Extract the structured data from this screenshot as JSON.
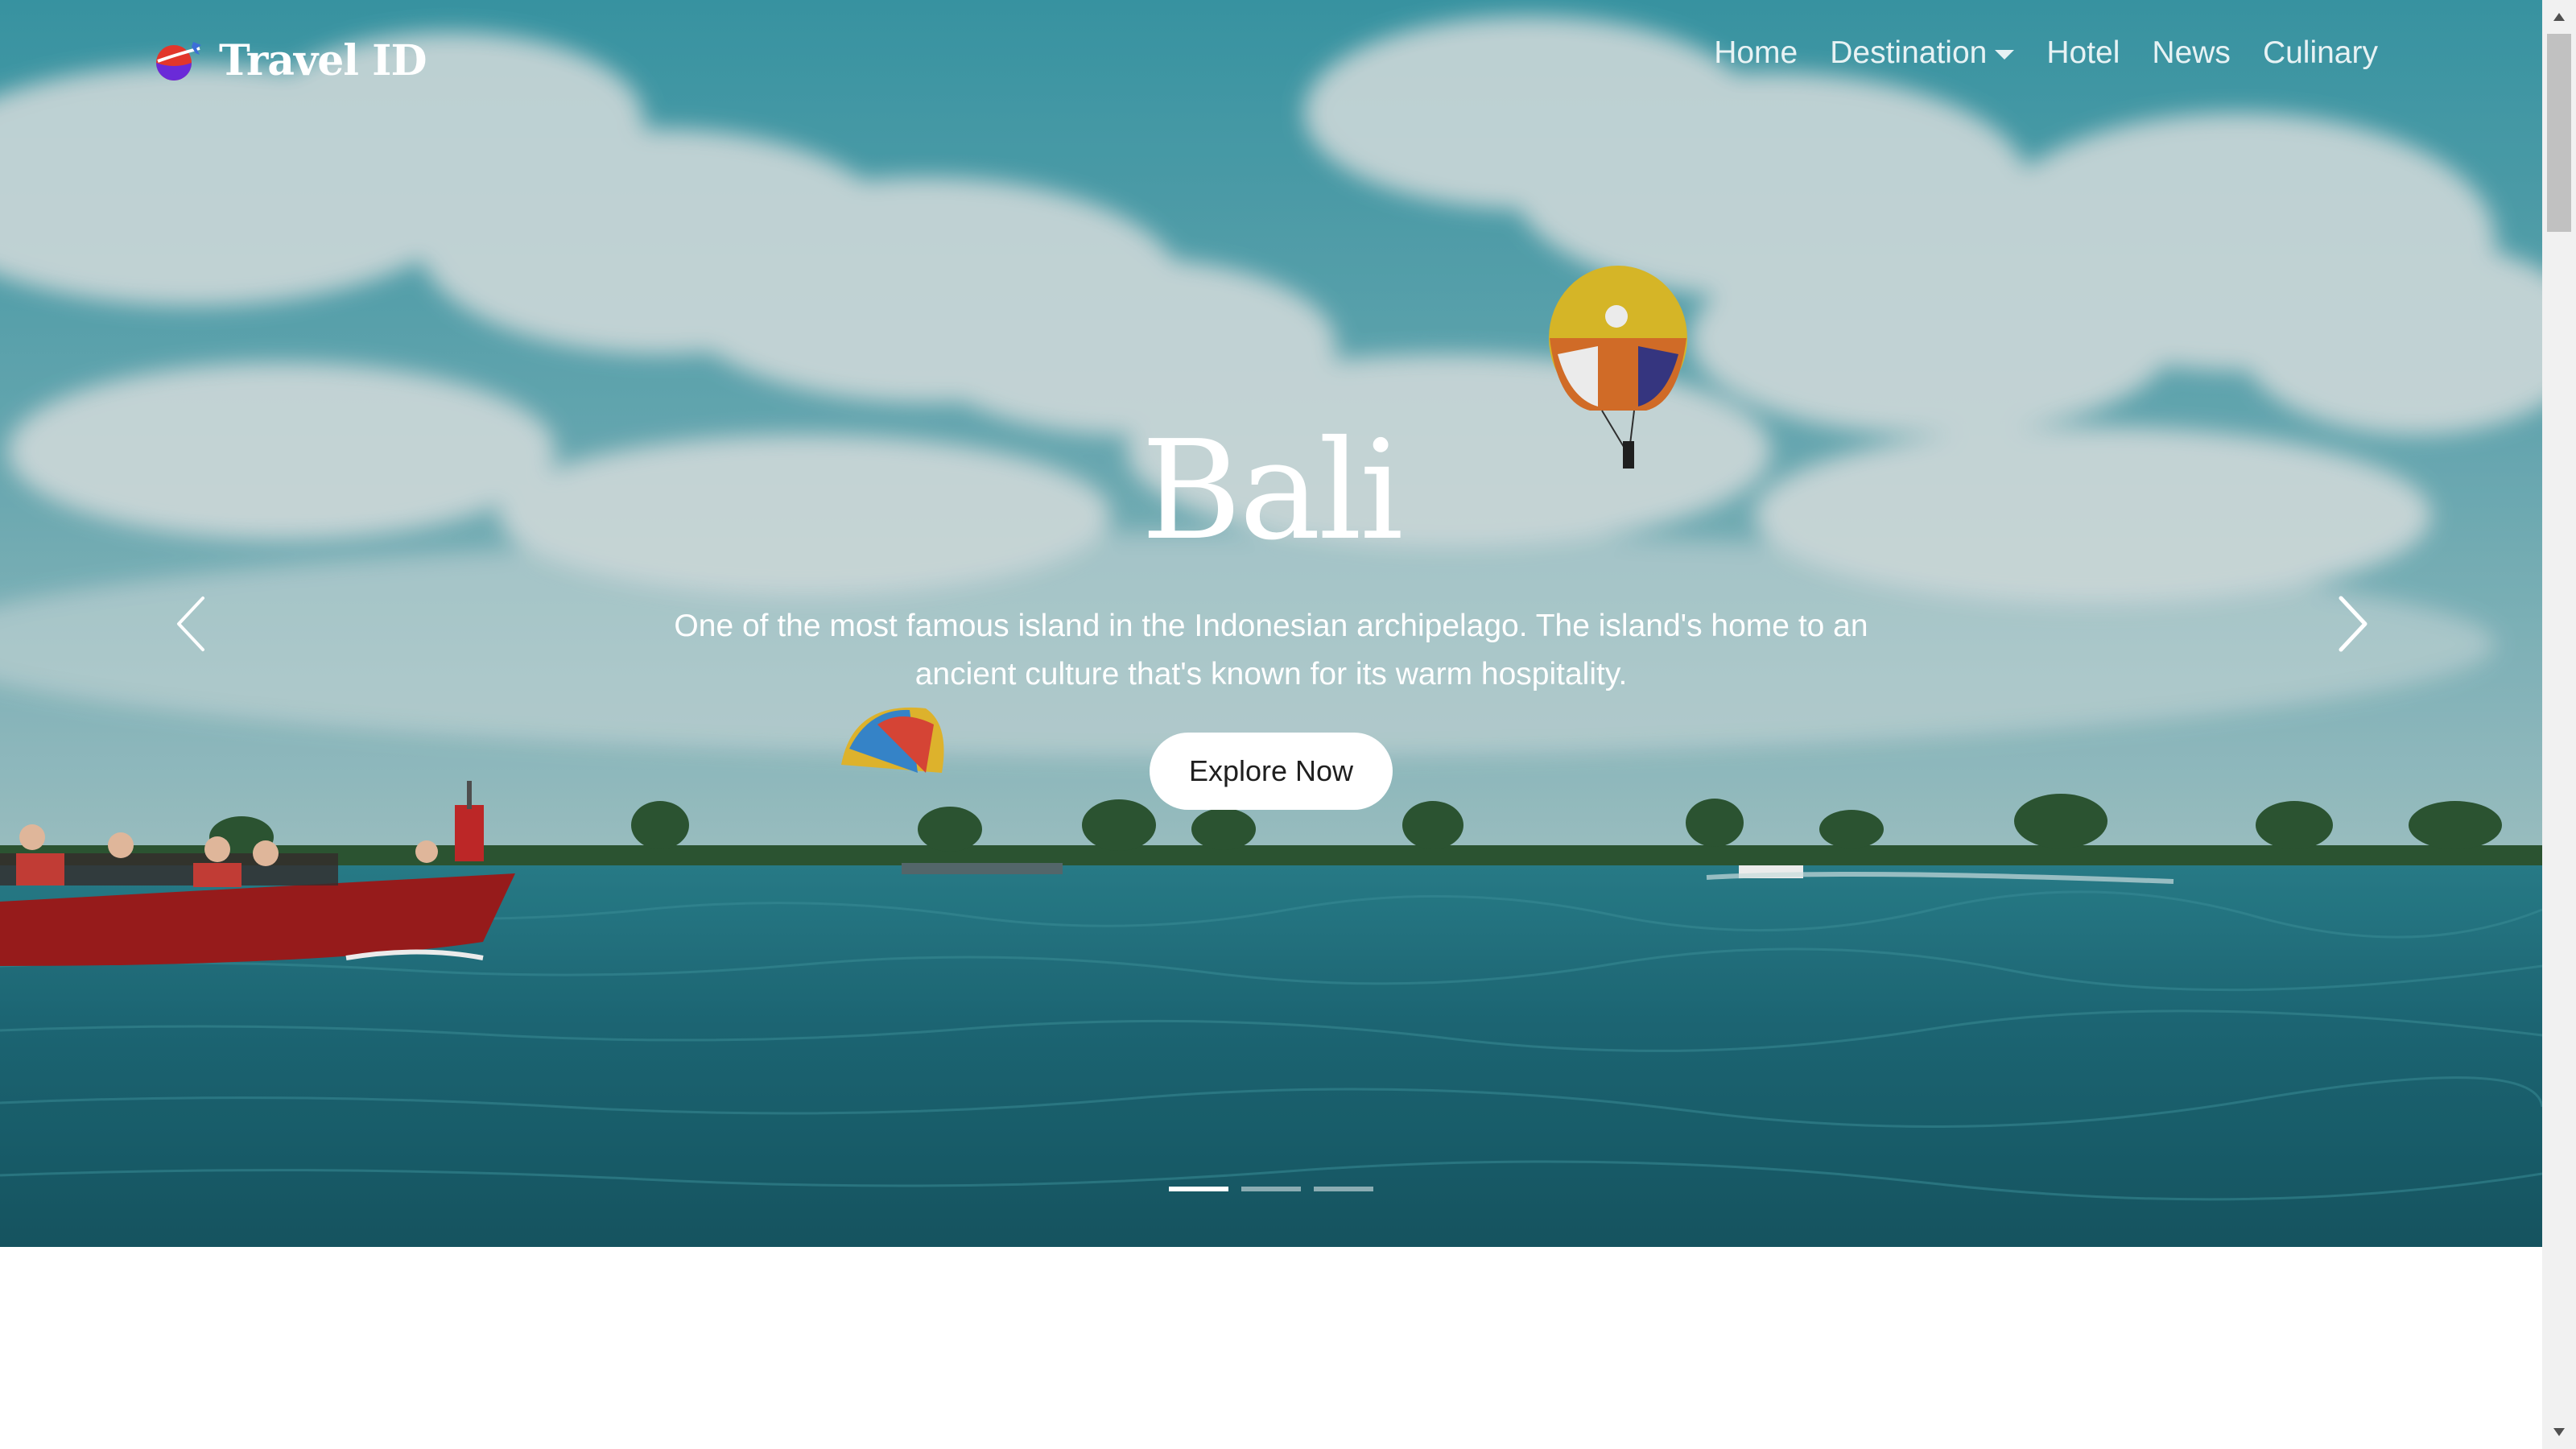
{
  "brand": {
    "name": "Travel ID",
    "logo_icon": "plane-globe-logo-icon"
  },
  "nav": {
    "items": [
      {
        "label": "Home",
        "dropdown": false
      },
      {
        "label": "Destination",
        "dropdown": true
      },
      {
        "label": "Hotel",
        "dropdown": false
      },
      {
        "label": "News",
        "dropdown": false
      },
      {
        "label": "Culinary",
        "dropdown": false
      }
    ]
  },
  "hero": {
    "title": "Bali",
    "description": "One of the most famous island in the Indonesian archipelago. The island's home to an ancient culture that's known for its warm hospitality.",
    "cta_label": "Explore Now",
    "prev_icon": "chevron-left-icon",
    "next_icon": "chevron-right-icon",
    "slide_count": 3,
    "active_slide": 1
  },
  "colors": {
    "sky": "#4fa3b3",
    "sea": "#1e6f7e",
    "text": "#ffffff",
    "button_bg": "#ffffff",
    "button_text": "#1f1f1f"
  }
}
